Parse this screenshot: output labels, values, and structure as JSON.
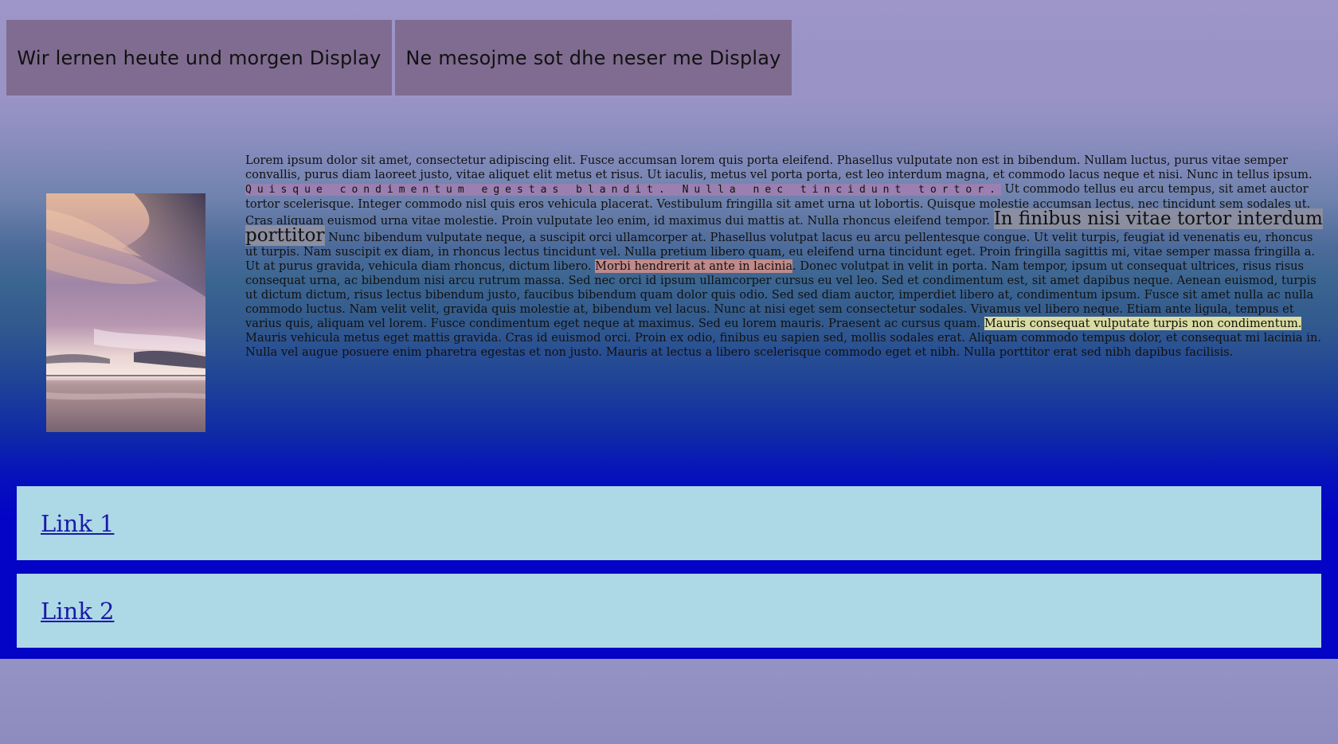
{
  "header": {
    "tabs": [
      {
        "label": "Wir lernen heute und morgen Display"
      },
      {
        "label": "Ne mesojme sot dhe neser me Display"
      }
    ]
  },
  "content": {
    "image_alt": "sunset sky over water",
    "text": {
      "p1": "Lorem ipsum dolor sit amet, consectetur adipiscing elit. Fusce accumsan lorem quis porta eleifend. Phasellus vulputate non est in bibendum. Nullam luctus, purus vitae semper convallis, purus diam laoreet justo, vitae aliquet elit metus et risus. Ut iaculis, metus vel porta porta, est leo interdum magna, et commodo lacus neque et nisi. Nunc in tellus ipsum. ",
      "hl1": "Quisque condimentum egestas blandit. Nulla nec tincidunt tortor.",
      "p2": " Ut commodo tellus eu arcu tempus, sit amet auctor tortor scelerisque. Integer commodo nisl quis eros vehicula placerat. Vestibulum fringilla sit amet urna ut lobortis. Quisque molestie accumsan lectus, nec tincidunt sem sodales ut. Cras aliquam euismod urna vitae molestie. Proin vulputate leo enim, id maximus dui mattis at. Nulla rhoncus eleifend tempor. ",
      "hl2": "In finibus nisi vitae tortor interdum porttitor",
      "p3": " Nunc bibendum vulputate neque, a suscipit orci ullamcorper at. Phasellus volutpat lacus eu arcu pellentesque congue. Ut velit turpis, feugiat id venenatis eu, rhoncus ut turpis. Nam suscipit ex diam, in rhoncus lectus tincidunt vel. Nulla pretium libero quam, eu eleifend urna tincidunt eget. Proin fringilla sagittis mi, vitae semper massa fringilla a. Ut at purus gravida, vehicula diam rhoncus, dictum libero. ",
      "hl3": "Morbi hendrerit at ante in lacinia",
      "p4": ". Donec volutpat in velit in porta. Nam tempor, ipsum ut consequat ultrices, risus risus consequat urna, ac bibendum nisi arcu rutrum massa. Sed nec orci id ipsum ullamcorper cursus eu vel leo. Sed et condimentum est, sit amet dapibus neque. Aenean euismod, turpis ut dictum dictum, risus lectus bibendum justo, faucibus bibendum quam dolor quis odio. Sed sed diam auctor, imperdiet libero at, condimentum ipsum. Fusce sit amet nulla ac nulla commodo luctus. Nam velit velit, gravida quis molestie at, bibendum vel lacus. Nunc at nisi eget sem consectetur sodales. Vivamus vel libero neque. Etiam ante ligula, tempus et varius quis, aliquam vel lorem. Fusce condimentum eget neque at maximus. Sed eu lorem mauris. Praesent ac cursus quam. ",
      "hl4": "Mauris consequat vulputate turpis non condimentum.",
      "p5": " Mauris vehicula metus eget mattis gravida. Cras id euismod orci. Proin ex odio, finibus eu sapien sed, mollis sodales erat. Aliquam commodo tempus dolor, et consequat mi lacinia in. Nulla vel augue posuere enim pharetra egestas et non justo. Mauris at lectus a libero scelerisque commodo eget et nibh. Nulla porttitor erat sed nibh dapibus facilisis."
    }
  },
  "links": [
    {
      "label": "Link 1"
    },
    {
      "label": "Link 2"
    }
  ],
  "colors": {
    "tab_bg": "#7f6c90",
    "link_box_bg": "#add8e6",
    "deep_blue": "#0404c6",
    "page_lavender": "#9a94c6"
  }
}
